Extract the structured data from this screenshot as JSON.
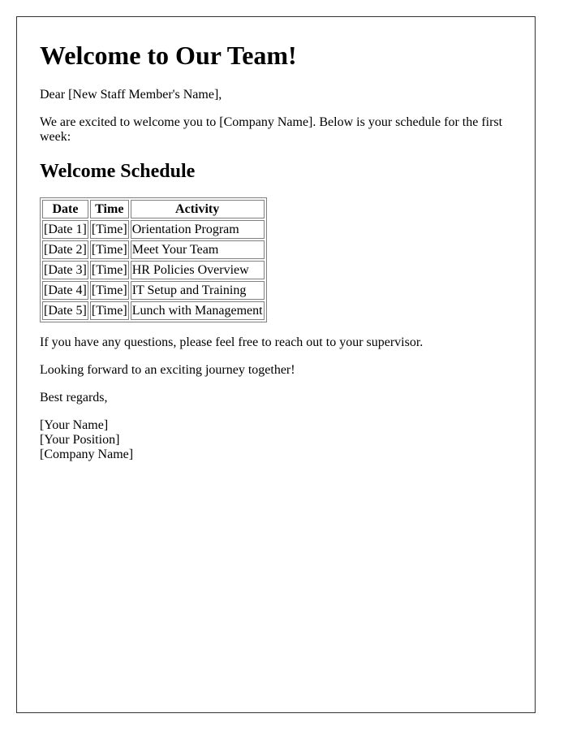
{
  "letter": {
    "title": "Welcome to Our Team!",
    "greeting": "Dear [New Staff Member's Name],",
    "intro": "We are excited to welcome you to [Company Name]. Below is your schedule for the first week:",
    "schedule_heading": "Welcome Schedule",
    "schedule": {
      "headers": [
        "Date",
        "Time",
        "Activity"
      ],
      "rows": [
        [
          "[Date 1]",
          "[Time]",
          "Orientation Program"
        ],
        [
          "[Date 2]",
          "[Time]",
          "Meet Your Team"
        ],
        [
          "[Date 3]",
          "[Time]",
          "HR Policies Overview"
        ],
        [
          "[Date 4]",
          "[Time]",
          "IT Setup and Training"
        ],
        [
          "[Date 5]",
          "[Time]",
          "Lunch with Management"
        ]
      ]
    },
    "questions": "If you have any questions, please feel free to reach out to your supervisor.",
    "closing_line": "Looking forward to an exciting journey together!",
    "sign_off": "Best regards,",
    "signature": {
      "name": "[Your Name]",
      "position": "[Your Position]",
      "company": "[Company Name]"
    }
  }
}
